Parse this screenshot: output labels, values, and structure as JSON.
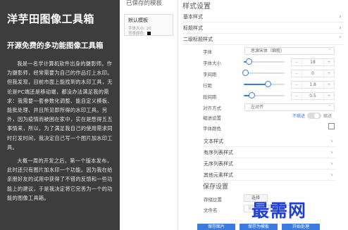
{
  "preview": {
    "title": "洋芋田图像工具箱",
    "subtitle": "开源免费的多功能图像工具箱",
    "paragraph1": "我是一名学计算机软件出身的摄影师。作为摄影师，经常需要为自己的作品打上水印。但我发现，目前市面上能找到的水印工具，无论是PC端还是移动端，都没办法满足我的需求：我需要一套参数化调整、能自定义模板、能批处理、并且所见即所得的水印工具。另外，因为疫情而被困在家中，实在是憋得五五事情来，所以，为了满足我自己的使用需求同时打发时间，我决定自己写一个图片加水印工具。",
    "paragraph2": "大概一周的开发之后，第一个版本发布，此时还只有图片加水印一个功能。因为我在给亲朋好友的试用中获得了不错的反馈和一些功能上的建议，于是我决定将它完善为一个的功能的图像工具箱。"
  },
  "templates": {
    "title": "已保存的模板",
    "card": {
      "name": "默认模板",
      "size_label": "字体大小: 20",
      "color_label": "背景颜色:"
    }
  },
  "settings": {
    "title": "样式设置",
    "sections": [
      {
        "label": "基本样式"
      },
      {
        "label": "标题样式"
      },
      {
        "label": "二级标题样式"
      }
    ],
    "font_label": "字体",
    "font_value": "思源宋体（细粗）",
    "font_size_label": "字体大小",
    "font_size_value": "18",
    "letter_spacing_label": "字间距",
    "letter_spacing_value": "0",
    "line_height_label": "行距",
    "line_height_value": "1.8",
    "para_spacing_label": "段间距",
    "para_spacing_value": "0.5",
    "align_label": "对齐方式",
    "align_value": "左对齐",
    "indent_label": "缩进设置",
    "indent_off": "不缩进",
    "indent_on": "缩进",
    "color_label": "字体颜色",
    "more_sections": [
      {
        "label": "文本样式"
      },
      {
        "label": "有序列表样式"
      },
      {
        "label": "无序列表样式"
      },
      {
        "label": "其他元素样式"
      }
    ],
    "slider_levels": {
      "font_size": 0.08,
      "letter_spacing": 0.0,
      "line_height": 0.55,
      "para_spacing": 0.15
    }
  },
  "save": {
    "title": "保存设置",
    "location_label": "存储位置",
    "location_button": "选择",
    "filename_label": "文件名",
    "filename_placeholder": "留输入文件名"
  },
  "actions": {
    "save_image": "保存图片",
    "save_template": "保存为模板",
    "batch": "开始处理"
  },
  "watermark": "最需网",
  "colors": {
    "accent": "#3a7be0",
    "panel_dark": "#3d3d3d"
  }
}
